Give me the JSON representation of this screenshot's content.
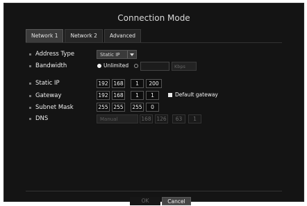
{
  "window": {
    "title": "Connection Mode"
  },
  "tabs": [
    "Network 1",
    "Network 2",
    "Advanced"
  ],
  "active_tab": "Network 1",
  "fields": {
    "address_type": {
      "label": "Address Type",
      "value": "Static IP"
    },
    "bandwidth": {
      "label": "Bandwidth",
      "option_unlimited": "Unlimited",
      "unit": "Kbps",
      "selected": "Unlimited"
    },
    "static_ip": {
      "label": "Static IP",
      "octets": [
        "192",
        "168",
        "1",
        "200"
      ]
    },
    "gateway": {
      "label": "Gateway",
      "octets": [
        "192",
        "168",
        "1",
        "1"
      ],
      "default_gateway_label": "Default gateway",
      "default_gateway_checked": true
    },
    "subnet_mask": {
      "label": "Subnet Mask",
      "octets": [
        "255",
        "255",
        "255",
        "0"
      ]
    },
    "dns": {
      "label": "DNS",
      "mode": "Manual",
      "octets": [
        "168",
        "126",
        "63",
        "1"
      ]
    }
  },
  "buttons": {
    "ok": "OK",
    "cancel": "Cancel"
  }
}
